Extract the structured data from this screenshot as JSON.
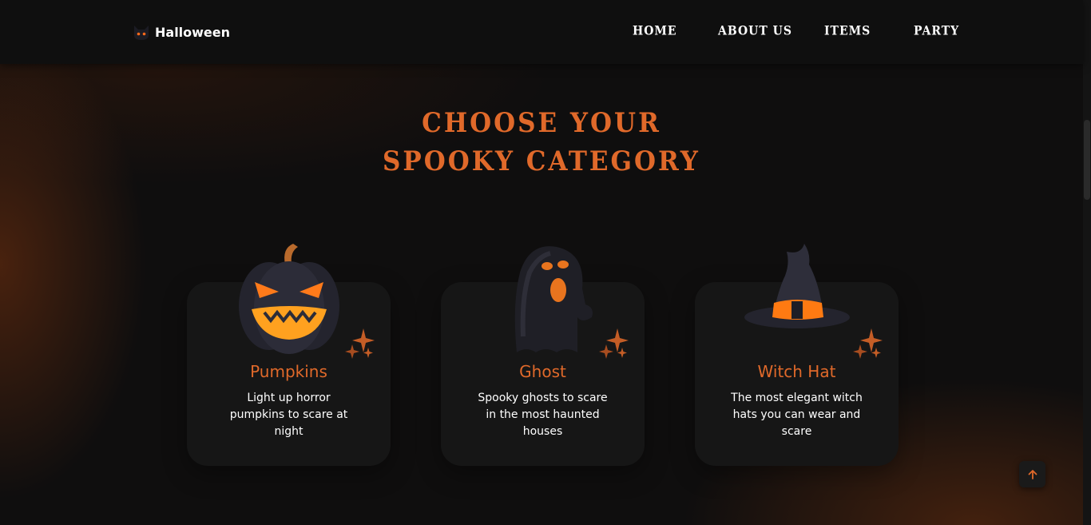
{
  "header": {
    "logo_text": "Halloween",
    "logo_icon": "cat-face-icon",
    "nav": [
      {
        "label": "Home"
      },
      {
        "label": "About us"
      },
      {
        "label": "Items"
      },
      {
        "label": "Party"
      }
    ]
  },
  "main": {
    "title_line1": "Choose your",
    "title_line2": "Spooky category",
    "cards": [
      {
        "title": "Pumpkins",
        "description": "Light up horror pumpkins to scare at night",
        "icon": "jack-o-lantern-icon"
      },
      {
        "title": "Ghost",
        "description": "Spooky ghosts to scare in the most haunted houses",
        "icon": "ghost-icon"
      },
      {
        "title": "Witch Hat",
        "description": "The most elegant witch hats you can wear and scare",
        "icon": "witch-hat-icon"
      }
    ]
  },
  "scroll_top": {
    "icon": "arrow-up-icon"
  },
  "colors": {
    "accent": "#e0692a",
    "background": "#0f0e0e",
    "card": "#161616",
    "header": "#0f0f0f"
  }
}
